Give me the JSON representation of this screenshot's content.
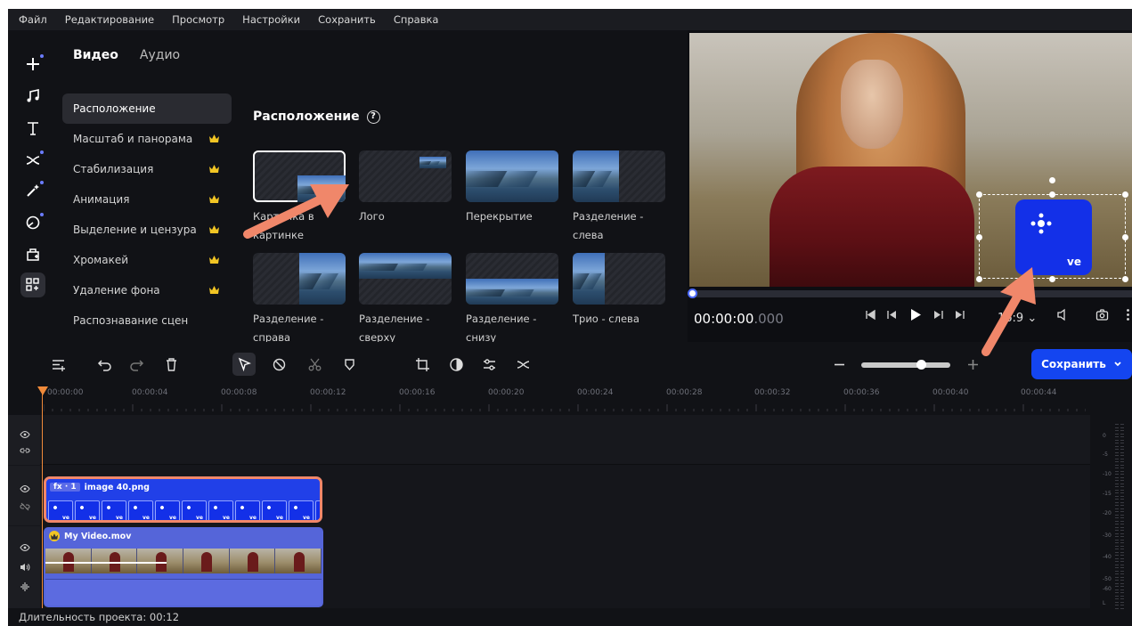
{
  "menu": [
    "Файл",
    "Редактирование",
    "Просмотр",
    "Настройки",
    "Сохранить",
    "Справка"
  ],
  "tabs": {
    "video": "Видео",
    "audio": "Аудио"
  },
  "categories": [
    {
      "label": "Расположение",
      "crown": false
    },
    {
      "label": "Масштаб и панорама",
      "crown": true
    },
    {
      "label": "Стабилизация",
      "crown": true
    },
    {
      "label": "Анимация",
      "crown": true
    },
    {
      "label": "Выделение и цензура",
      "crown": true
    },
    {
      "label": "Хромакей",
      "crown": true
    },
    {
      "label": "Удаление фона",
      "crown": true
    },
    {
      "label": "Распознавание сцен",
      "crown": false
    }
  ],
  "section": {
    "title": "Расположение"
  },
  "layouts": [
    {
      "label": "Картинка в картинке"
    },
    {
      "label": "Лого"
    },
    {
      "label": "Перекрытие"
    },
    {
      "label": "Разделение - слева"
    },
    {
      "label": "Разделение - справа"
    },
    {
      "label": "Разделение - сверху"
    },
    {
      "label": "Разделение - снизу"
    },
    {
      "label": "Трио - слева"
    }
  ],
  "preview": {
    "timecode_main": "00:00:00",
    "timecode_ms": ".000",
    "aspect_ratio": "16:9",
    "logo_text": "ve"
  },
  "save_button": "Сохранить",
  "ruler": [
    "00:00:00",
    "00:00:04",
    "00:00:08",
    "00:00:12",
    "00:00:16",
    "00:00:20",
    "00:00:24",
    "00:00:28",
    "00:00:32",
    "00:00:36",
    "00:00:40",
    "00:00:44"
  ],
  "clips": {
    "overlay": {
      "fx": "fx · 1",
      "name": "image 40.png"
    },
    "video": {
      "name": "My Video.mov"
    }
  },
  "meter_labels": [
    "0",
    "-5",
    "-10",
    "-15",
    "-20",
    "-30",
    "-40",
    "-50",
    "-60",
    "L"
  ],
  "status": "Длительность проекта: 00:12",
  "colors": {
    "accent": "#1445f0",
    "highlight": "#f0876a",
    "clip_blue": "#2140e8"
  }
}
